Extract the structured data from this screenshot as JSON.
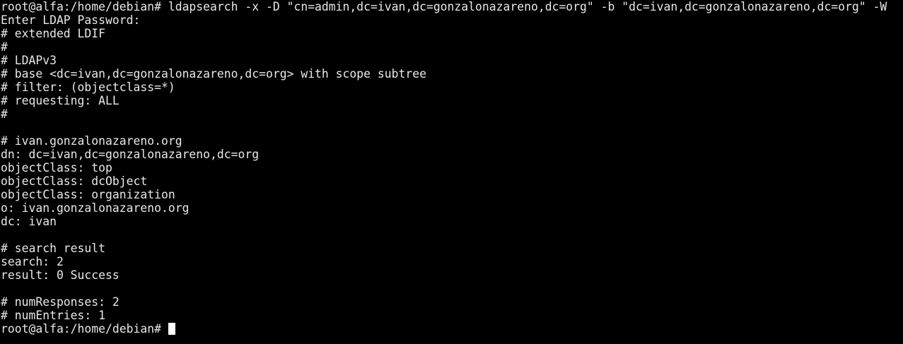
{
  "colors": {
    "background": "#000000",
    "foreground": "#e8e8e8",
    "cursor": "#ffffff"
  },
  "terminal": {
    "lines": [
      "root@alfa:/home/debian# ldapsearch -x -D \"cn=admin,dc=ivan,dc=gonzalonazareno,dc=org\" -b \"dc=ivan,dc=gonzalonazareno,dc=org\" -W",
      "Enter LDAP Password:",
      "# extended LDIF",
      "#",
      "# LDAPv3",
      "# base <dc=ivan,dc=gonzalonazareno,dc=org> with scope subtree",
      "# filter: (objectclass=*)",
      "# requesting: ALL",
      "#",
      "",
      "# ivan.gonzalonazareno.org",
      "dn: dc=ivan,dc=gonzalonazareno,dc=org",
      "objectClass: top",
      "objectClass: dcObject",
      "objectClass: organization",
      "o: ivan.gonzalonazareno.org",
      "dc: ivan",
      "",
      "# search result",
      "search: 2",
      "result: 0 Success",
      "",
      "# numResponses: 2",
      "# numEntries: 1"
    ],
    "prompt": "root@alfa:/home/debian# "
  }
}
